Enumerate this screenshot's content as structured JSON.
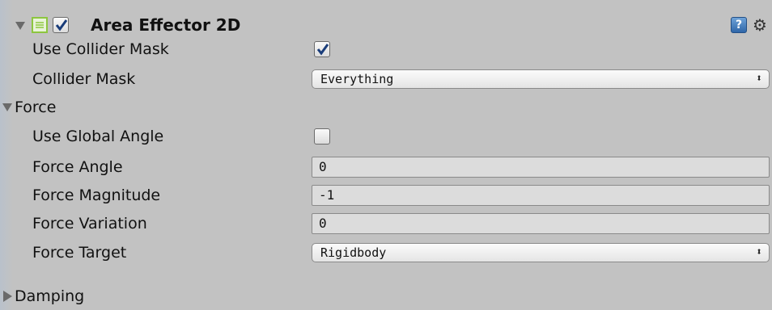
{
  "component": {
    "title": "Area Effector 2D",
    "enabled": true,
    "help_glyph": "?",
    "gear_glyph": "⚙"
  },
  "rows": {
    "use_collider_mask": {
      "label": "Use Collider Mask",
      "checked": true
    },
    "collider_mask": {
      "label": "Collider Mask",
      "value": "Everything",
      "arrow": "⬍"
    },
    "force_foldout": {
      "label": "Force",
      "expanded": true
    },
    "use_global_angle": {
      "label": "Use Global Angle",
      "checked": false
    },
    "force_angle": {
      "label": "Force Angle",
      "value": "0"
    },
    "force_magnitude": {
      "label": "Force Magnitude",
      "value": "-1"
    },
    "force_variation": {
      "label": "Force Variation",
      "value": "0"
    },
    "force_target": {
      "label": "Force Target",
      "value": "Rigidbody",
      "arrow": "⬍"
    },
    "damping_foldout": {
      "label": "Damping",
      "expanded": false
    }
  },
  "colors": {
    "script_icon_border": "#8dc63f",
    "help_icon": "#3a73b5"
  }
}
